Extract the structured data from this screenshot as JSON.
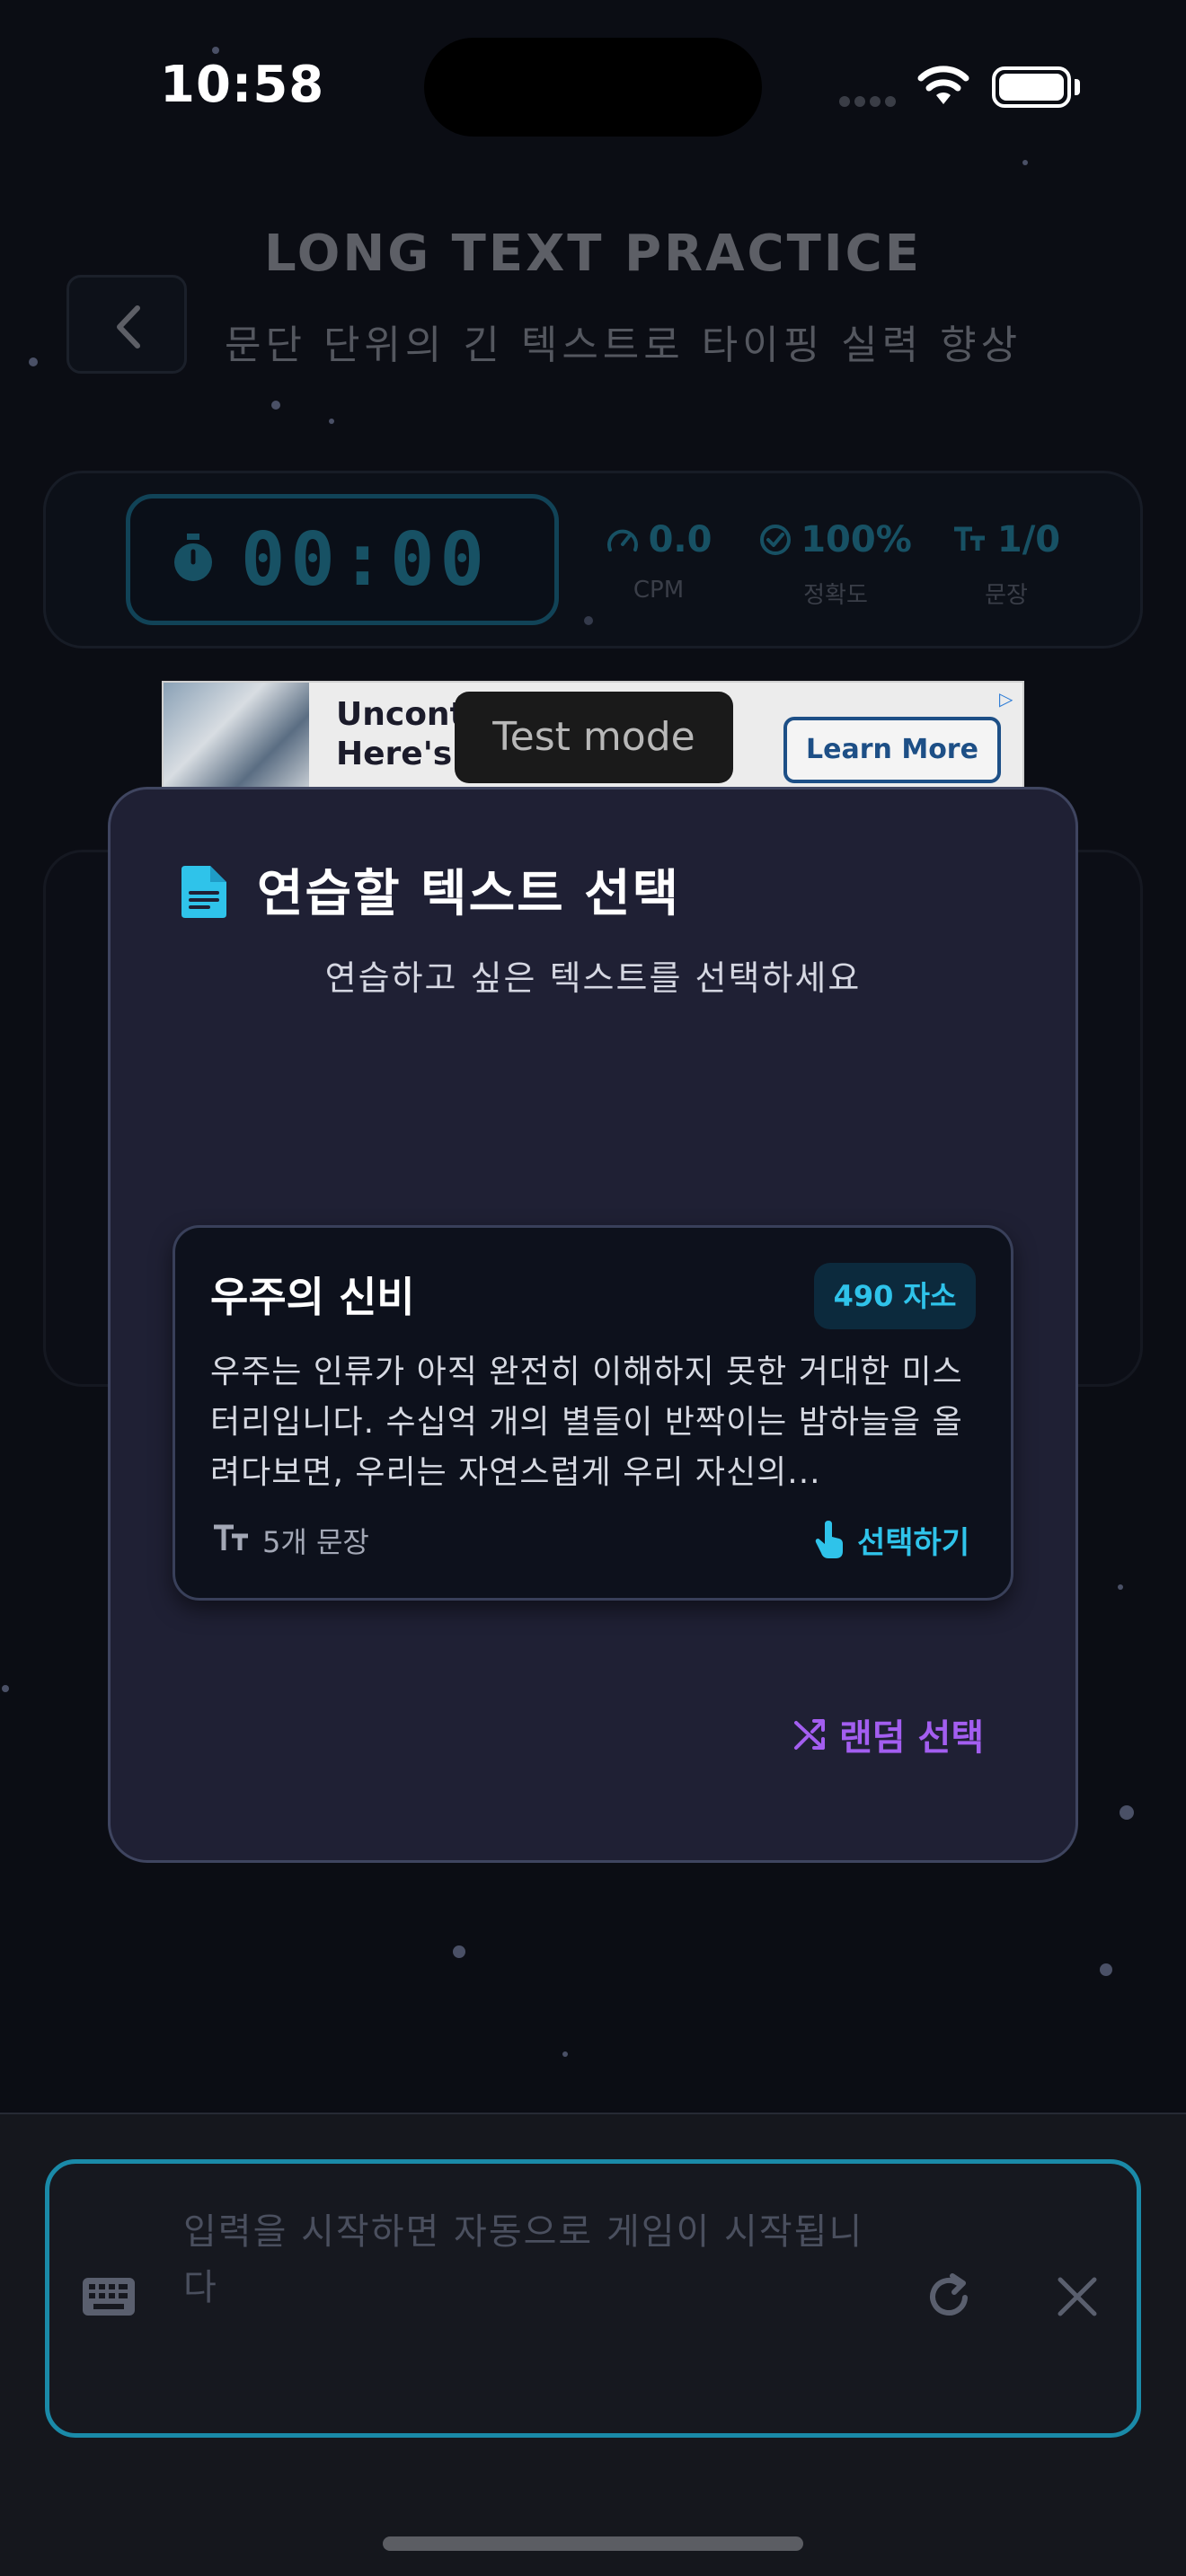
{
  "status_bar": {
    "time": "10:58"
  },
  "header": {
    "title": "LONG TEXT PRACTICE",
    "subtitle": "문단 단위의 긴 텍스트로 타이핑 실력 향상"
  },
  "stats": {
    "timer": "00:00",
    "cpm_value": "0.0",
    "cpm_label": "CPM",
    "accuracy_value": "100%",
    "accuracy_label": "정확도",
    "sentence_value": "1/0",
    "sentence_label": "문장"
  },
  "ad": {
    "headline_line1": "Uncontr",
    "headline_line2": "Here's W",
    "cta": "Learn More",
    "test_mode": "Test mode"
  },
  "modal": {
    "title": "연습할 텍스트 선택",
    "subtitle": "연습하고 싶은 텍스트를 선택하세요",
    "card": {
      "title": "우주의 신비",
      "badge": "490 자소",
      "body": "우주는 인류가 아직 완전히 이해하지 못한 거대한 미스터리입니다. 수십억 개의 별들이 반짝이는 밤하늘을 올려다보면, 우리는 자연스럽게 우리 자신의...",
      "sentence_count": "5개 문장",
      "select_label": "선택하기"
    },
    "random_label": "랜덤 선택"
  },
  "input": {
    "placeholder": "입력을 시작하면 자동으로 게임이 시작됩니다"
  },
  "colors": {
    "accent": "#2fc3ea",
    "purple": "#a35ef0",
    "background": "#0b0d14",
    "modal": "#1f2034"
  },
  "icons": [
    "timer-icon",
    "gauge-icon",
    "check-circle-icon",
    "text-size-icon",
    "document-icon",
    "tap-icon",
    "shuffle-icon",
    "keyboard-icon",
    "reload-icon",
    "close-icon",
    "chevron-left-icon"
  ]
}
